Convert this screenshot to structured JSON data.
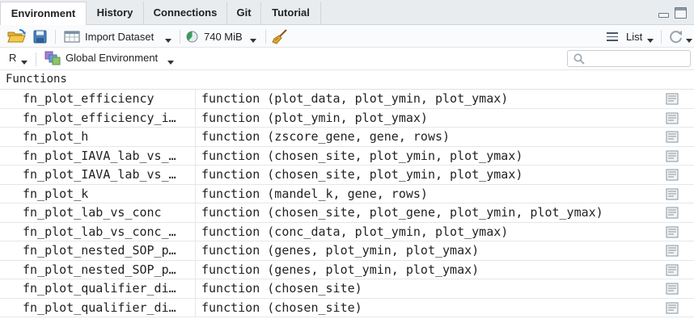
{
  "tabs": [
    {
      "label": "Environment",
      "active": true
    },
    {
      "label": "History",
      "active": false
    },
    {
      "label": "Connections",
      "active": false
    },
    {
      "label": "Git",
      "active": false
    },
    {
      "label": "Tutorial",
      "active": false
    }
  ],
  "toolbar": {
    "import_label": "Import Dataset",
    "memory_label": "740 MiB",
    "view_label": "List"
  },
  "envbar": {
    "language": "R",
    "environment": "Global Environment"
  },
  "section_title": "Functions",
  "rows": [
    {
      "name": "fn_plot_efficiency",
      "value": "function (plot_data, plot_ymin, plot_ymax)"
    },
    {
      "name": "fn_plot_efficiency_i…",
      "value": "function (plot_ymin, plot_ymax)"
    },
    {
      "name": "fn_plot_h",
      "value": "function (zscore_gene, gene, rows)"
    },
    {
      "name": "fn_plot_IAVA_lab_vs_…",
      "value": "function (chosen_site, plot_ymin, plot_ymax)"
    },
    {
      "name": "fn_plot_IAVA_lab_vs_…",
      "value": "function (chosen_site, plot_ymin, plot_ymax)"
    },
    {
      "name": "fn_plot_k",
      "value": "function (mandel_k, gene, rows)"
    },
    {
      "name": "fn_plot_lab_vs_conc",
      "value": "function (chosen_site, plot_gene, plot_ymin, plot_ymax)"
    },
    {
      "name": "fn_plot_lab_vs_conc_…",
      "value": "function (conc_data, plot_ymin, plot_ymax)"
    },
    {
      "name": "fn_plot_nested_SOP_p…",
      "value": "function (genes, plot_ymin, plot_ymax)"
    },
    {
      "name": "fn_plot_nested_SOP_p…",
      "value": "function (genes, plot_ymin, plot_ymax)"
    },
    {
      "name": "fn_plot_qualifier_di…",
      "value": "function (chosen_site)"
    },
    {
      "name": "fn_plot_qualifier_di…",
      "value": "function (chosen_site)"
    }
  ]
}
